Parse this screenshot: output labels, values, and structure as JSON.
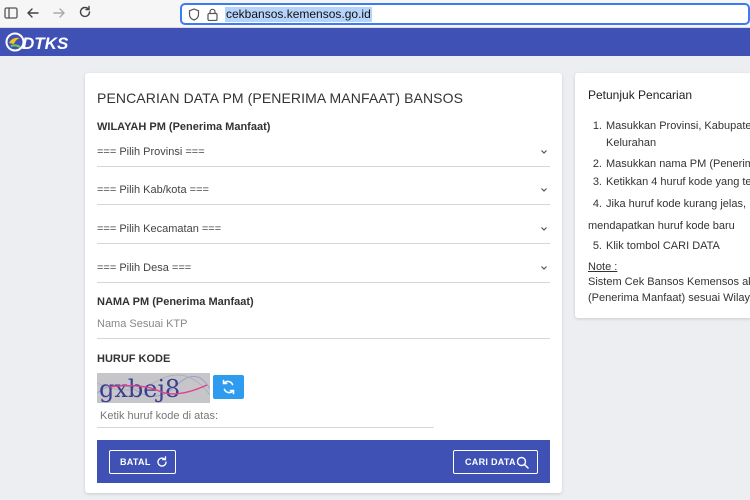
{
  "browser": {
    "url": "cekbansos.kemensos.go.id",
    "icons": [
      "sidebar-icon",
      "back-arrow-icon",
      "forward-arrow-icon",
      "reload-icon",
      "shield-icon",
      "lock-icon"
    ]
  },
  "header": {
    "logo_text": "DTKS",
    "color": "#3f51b5"
  },
  "form": {
    "title": "PENCARIAN DATA PM (PENERIMA MANFAAT) BANSOS",
    "region_label": "WILAYAH PM (Penerima Manfaat)",
    "selects": [
      {
        "value": "=== Pilih Provinsi ==="
      },
      {
        "value": "=== Pilih Kab/kota ==="
      },
      {
        "value": "=== Pilih Kecamatan ==="
      },
      {
        "value": "=== Pilih Desa ==="
      }
    ],
    "name_label": "NAMA PM (Penerima Manfaat)",
    "name_placeholder": "Nama Sesuai KTP",
    "code_label": "HURUF KODE",
    "captcha_text": "gxbej8",
    "code_placeholder": "Ketik huruf kode di atas:",
    "cancel_label": "BATAL",
    "search_label": "CARI DATA",
    "refresh_color": "#2d9cf0"
  },
  "instructions": {
    "title": "Petunjuk Pencarian",
    "items": [
      {
        "num": "1.",
        "lines": [
          "Masukkan Provinsi, Kabupate",
          "Kelurahan"
        ]
      },
      {
        "num": "2.",
        "lines": [
          "Masukkan nama PM (Penerim"
        ]
      },
      {
        "num": "3.",
        "lines": [
          "Ketikkan 4 huruf kode yang te"
        ]
      },
      {
        "num": "4.",
        "lines": [
          "Jika huruf kode kurang jelas,",
          "mendapatkan huruf kode baru"
        ]
      },
      {
        "num": "5.",
        "lines": [
          "Klik tombol CARI DATA"
        ]
      }
    ],
    "note_label": "Note :",
    "note_lines": [
      "Sistem Cek Bansos Kemensos akan",
      "(Penerima Manfaat) sesuai Wilayah"
    ]
  }
}
